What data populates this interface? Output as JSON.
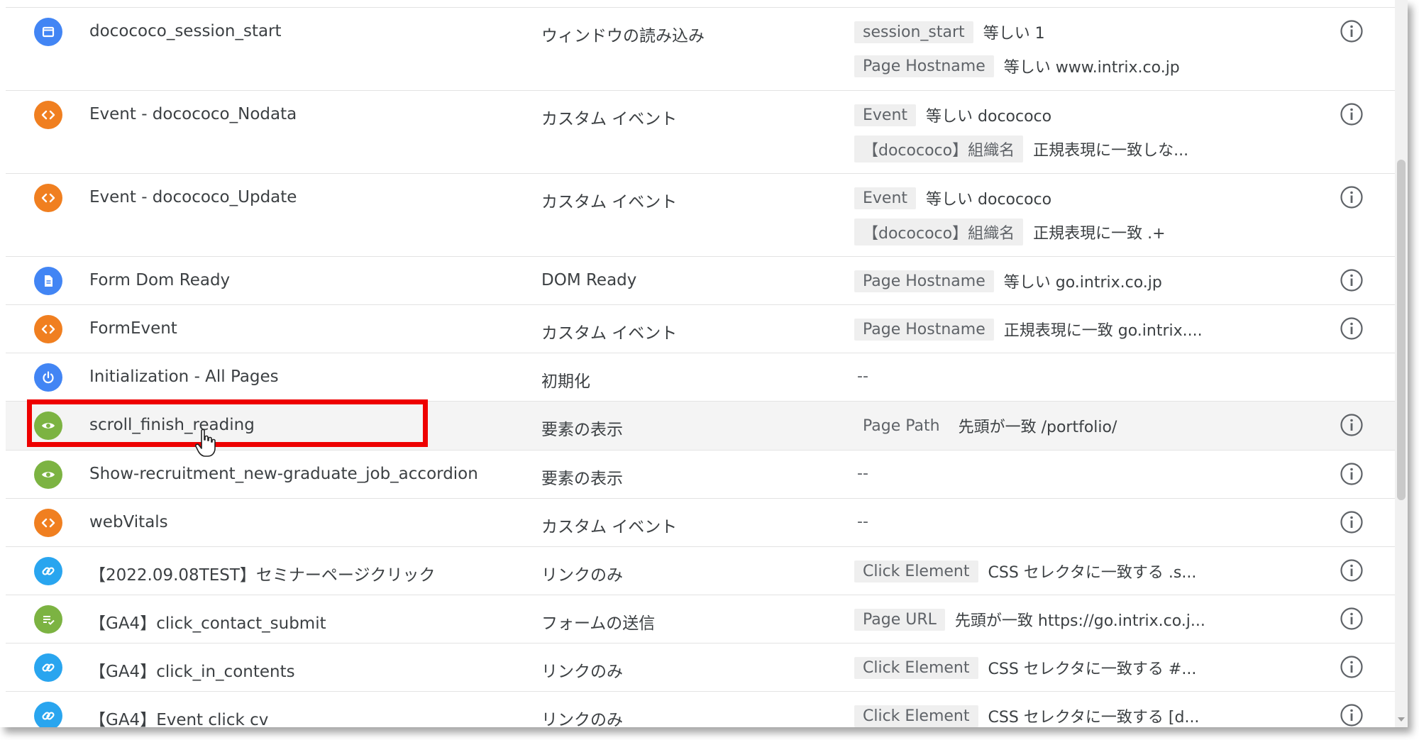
{
  "rows": [
    {
      "name": "docococo_session_start",
      "type": "ウィンドウの読み込み",
      "icon": "window-icon",
      "filters": [
        {
          "var": "session_start",
          "cond": "等しい 1"
        },
        {
          "var": "Page Hostname",
          "cond": "等しい www.intrix.co.jp"
        }
      ]
    },
    {
      "name": "Event - docococo_Nodata",
      "type": "カスタム イベント",
      "icon": "code-icon",
      "filters": [
        {
          "var": "Event",
          "cond": "等しい docococo"
        },
        {
          "var": "【docococo】組織名",
          "cond": "正規表現に一致しな..."
        }
      ]
    },
    {
      "name": "Event - docococo_Update",
      "type": "カスタム イベント",
      "icon": "code-icon",
      "filters": [
        {
          "var": "Event",
          "cond": "等しい docococo"
        },
        {
          "var": "【docococo】組織名",
          "cond": "正規表現に一致 .+"
        }
      ]
    },
    {
      "name": "Form Dom Ready",
      "type": "DOM Ready",
      "icon": "document-icon",
      "filters": [
        {
          "var": "Page Hostname",
          "cond": "等しい go.intrix.co.jp"
        }
      ]
    },
    {
      "name": "FormEvent",
      "type": "カスタム イベント",
      "icon": "code-icon",
      "filters": [
        {
          "var": "Page Hostname",
          "cond": "正規表現に一致 go.intrix...."
        }
      ]
    },
    {
      "name": "Initialization - All Pages",
      "type": "初期化",
      "icon": "power-icon",
      "filters_empty": "--"
    },
    {
      "name": "scroll_finish_reading",
      "type": "要素の表示",
      "icon": "eye-icon",
      "filters": [
        {
          "var": "Page Path",
          "cond": "先頭が一致 /portfolio/"
        }
      ]
    },
    {
      "name": "Show-recruitment_new-graduate_job_accordion",
      "type": "要素の表示",
      "icon": "eye-icon",
      "filters_empty": "--"
    },
    {
      "name": "webVitals",
      "type": "カスタム イベント",
      "icon": "code-icon",
      "filters_empty": "--"
    },
    {
      "name": "【2022.09.08TEST】セミナーページクリック",
      "type": "リンクのみ",
      "icon": "link-icon",
      "filters": [
        {
          "var": "Click Element",
          "cond": "CSS セレクタに一致する .s..."
        }
      ]
    },
    {
      "name": "【GA4】click_contact_submit",
      "type": "フォームの送信",
      "icon": "form-submit-icon",
      "filters": [
        {
          "var": "Page URL",
          "cond": "先頭が一致 https://go.intrix.co.j..."
        }
      ]
    },
    {
      "name": "【GA4】click_in_contents",
      "type": "リンクのみ",
      "icon": "link-icon",
      "filters": [
        {
          "var": "Click Element",
          "cond": "CSS セレクタに一致する #..."
        }
      ]
    },
    {
      "name": "【GA4】Event click cv",
      "type": "リンクのみ",
      "icon": "link-icon",
      "filters": [
        {
          "var": "Click Element",
          "cond": "CSS セレクタに一致する [d..."
        }
      ]
    }
  ],
  "colors": {
    "blue": "#4285f4",
    "orange": "#f07f20",
    "green": "#7cb342",
    "light_blue": "#29a5ef",
    "highlight": "#ee0000"
  }
}
